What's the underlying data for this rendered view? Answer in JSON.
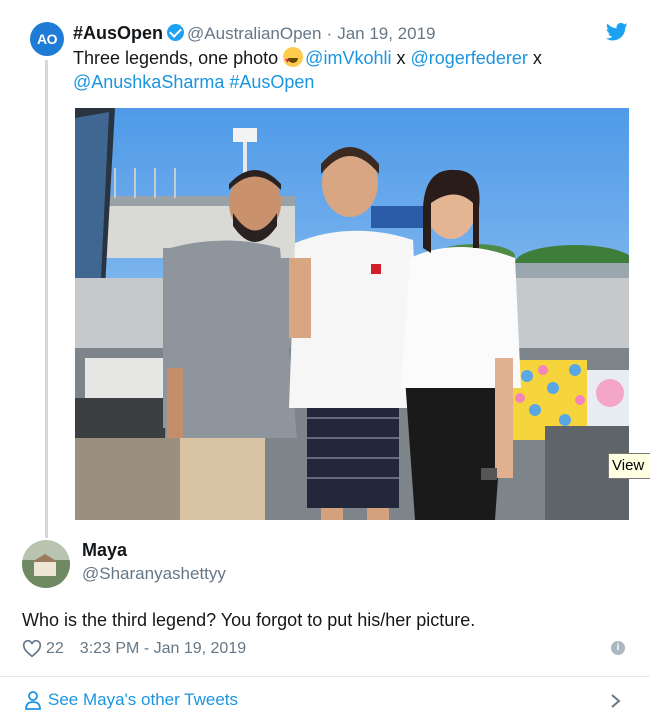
{
  "quoted_tweet": {
    "avatar_text": "AO",
    "name": "#AusOpen",
    "handle": "@AustralianOpen",
    "separator": "·",
    "date": "Jan 19, 2019",
    "text_before_emoji": "Three legends, one photo",
    "mention_1": "@imVkohli",
    "x_1": "x",
    "mention_2": "@rogerfederer",
    "x_2": "x",
    "mention_3": "@AnushkaSharma",
    "hashtag": "#AusOpen",
    "emoji": "smiling-face-with-heart-eyes-icon"
  },
  "reply": {
    "name": "Maya",
    "handle": "@Sharanyashettyy",
    "text": "Who is the third legend? You forgot to put his/her picture.",
    "likes": "22",
    "timestamp": "3:23 PM - Jan 19, 2019"
  },
  "footer": {
    "see_more": "See Maya's other Tweets"
  },
  "tooltip": {
    "text": "View"
  },
  "colors": {
    "link": "#1b95e0",
    "brand": "#1da1f2",
    "ao_blue": "#1e7cd6",
    "muted": "#657786"
  }
}
